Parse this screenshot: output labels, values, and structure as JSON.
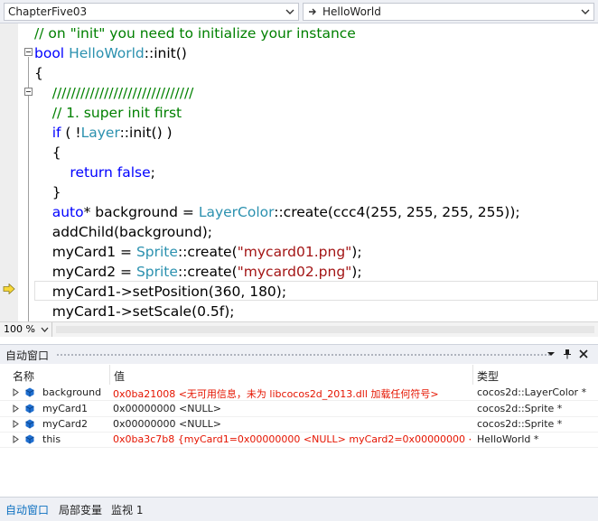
{
  "navigation": {
    "project_combo": "ChapterFive03",
    "member_combo": "HelloWorld"
  },
  "editor": {
    "zoom": "100 %",
    "lines": [
      [
        [
          "comment",
          "// on \"init\" you need to initialize your instance"
        ]
      ],
      [
        [
          "keyword",
          "bool"
        ],
        [
          "plain",
          " "
        ],
        [
          "type",
          "HelloWorld"
        ],
        [
          "plain",
          "::init()"
        ]
      ],
      [
        [
          "plain",
          "{"
        ]
      ],
      [
        [
          "plain",
          "    "
        ],
        [
          "comment",
          "//////////////////////////////"
        ]
      ],
      [
        [
          "plain",
          "    "
        ],
        [
          "comment",
          "// 1. super init first"
        ]
      ],
      [
        [
          "plain",
          "    "
        ],
        [
          "keyword",
          "if"
        ],
        [
          "plain",
          " ( !"
        ],
        [
          "type",
          "Layer"
        ],
        [
          "plain",
          "::init() )"
        ]
      ],
      [
        [
          "plain",
          "    {"
        ]
      ],
      [
        [
          "plain",
          "        "
        ],
        [
          "keyword",
          "return"
        ],
        [
          "plain",
          " "
        ],
        [
          "keyword",
          "false"
        ],
        [
          "plain",
          ";"
        ]
      ],
      [
        [
          "plain",
          "    }"
        ]
      ],
      [
        [
          "plain",
          "    "
        ],
        [
          "keyword",
          "auto"
        ],
        [
          "plain",
          "* background = "
        ],
        [
          "type",
          "LayerColor"
        ],
        [
          "plain",
          "::create(ccc4(255, 255, 255, 255));"
        ]
      ],
      [
        [
          "plain",
          "    addChild(background);"
        ]
      ],
      [
        [
          "plain",
          "    myCard1 = "
        ],
        [
          "type",
          "Sprite"
        ],
        [
          "plain",
          "::create("
        ],
        [
          "string",
          "\"mycard01.png\""
        ],
        [
          "plain",
          ");"
        ]
      ],
      [
        [
          "plain",
          "    myCard2 = "
        ],
        [
          "type",
          "Sprite"
        ],
        [
          "plain",
          "::create("
        ],
        [
          "string",
          "\"mycard02.png\""
        ],
        [
          "plain",
          ");"
        ]
      ],
      [
        [
          "plain",
          "    myCard1->setPosition(360, 180);"
        ]
      ],
      [
        [
          "plain",
          "    myCard1->setScale(0.5f);"
        ]
      ]
    ]
  },
  "autos_window": {
    "title": "自动窗口",
    "columns": {
      "name": "名称",
      "value": "值",
      "type": "类型"
    },
    "rows": [
      {
        "name": "background",
        "value": "0x0ba21008 <无可用信息，未为 libcocos2d_2013.dll 加载任何符号>",
        "type": "cocos2d::LayerColor *",
        "changed": true
      },
      {
        "name": "myCard1",
        "value": "0x00000000 <NULL>",
        "type": "cocos2d::Sprite *",
        "changed": false
      },
      {
        "name": "myCard2",
        "value": "0x00000000 <NULL>",
        "type": "cocos2d::Sprite *",
        "changed": false
      },
      {
        "name": "this",
        "value": "0x0ba3c7b8 {myCard1=0x00000000 <NULL> myCard2=0x00000000 <NULL> ...",
        "type": "HelloWorld *",
        "changed": true
      }
    ],
    "tabs": [
      "自动窗口",
      "局部变量",
      "监视 1"
    ]
  },
  "colors": {
    "comment": "#008000",
    "keyword": "#0000ff",
    "type": "#2b91af",
    "string": "#a31515",
    "changed_value": "#e51400",
    "active_tab": "#0e70c0"
  },
  "icons": {
    "member_combo": "method-arrow-icon",
    "current_statement": "execution-arrow-icon",
    "row_variable": "field-cube-icon"
  }
}
